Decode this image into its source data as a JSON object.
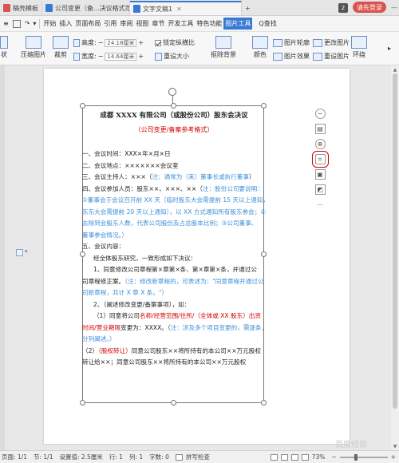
{
  "tabs": [
    {
      "label": "稿壳模板",
      "active": false
    },
    {
      "label": "公司变更（备...决议格式范本",
      "active": false
    },
    {
      "label": "文字文稿1",
      "active": true
    }
  ],
  "tab_badge": "2",
  "login_label": "请先登录",
  "menu": {
    "file_icon": "menu-lines-icon",
    "items": [
      "开始",
      "插入",
      "页面布局",
      "引用",
      "审阅",
      "视图",
      "章节",
      "开发工具",
      "特色功能",
      "图片工具"
    ],
    "active_item": "图片工具",
    "search_label": "Q查找"
  },
  "ribbon": {
    "left_cut": "状",
    "compress_label": "压缩图片",
    "crop_label": "裁剪",
    "height_label": "高度:",
    "height_value": "24.18厘米",
    "width_label": "宽度:",
    "width_value": "14.64厘米",
    "lock_ratio_label": "锁定纵横比",
    "reset_size_label": "重设大小",
    "matting_label": "抠除背景",
    "color_label": "颜色",
    "picture_outline_label": "图片轮廓",
    "change_picture_label": "更改图片",
    "picture_effect_label": "图片效果",
    "reset_picture_label": "重设图片",
    "wrap_label": "环绕"
  },
  "document": {
    "title": "成都 XXXX 有限公司（或股份公司）股东会决议",
    "subtitle": "（公司变更/备案参考格式）",
    "lines": [
      {
        "type": "plain",
        "text": "一、会议时间：XXX×年×月×日"
      },
      {
        "type": "plain",
        "text": "二、会议地点：×××××××会议室"
      },
      {
        "type": "mixed",
        "parts": [
          [
            "plain",
            "三、会议主持人：×××（"
          ],
          [
            "blue",
            "注：通常为（来）董事长或执行董事"
          ],
          [
            "plain",
            "）"
          ]
        ]
      },
      {
        "type": "mixed",
        "parts": [
          [
            "plain",
            "四、会议参加人员：股东××、×××、××（"
          ],
          [
            "blue",
            "注：股份公司要说明："
          ]
        ]
      },
      {
        "type": "blue",
        "text": "①董事会于会议召开前 XX 天（临时股东大会需提前 15 天以上通知，"
      },
      {
        "type": "blue",
        "text": "东东大会需提前 20 天以上通知），以 XX 方式通知所有股东参会；②"
      },
      {
        "type": "blue",
        "text": "去除到会股东人数，代表公司股份及占总股本比例；③公司董事、"
      },
      {
        "type": "blue",
        "text": "董事参会情况。）"
      },
      {
        "type": "plain",
        "text": "五、会议内容："
      },
      {
        "type": "plain",
        "indent": true,
        "text": "经全体股东研究，一致形成如下决议："
      },
      {
        "type": "plain",
        "indent": true,
        "text": "1、同意修改公司章程第×章第×条、第×章第×条，并通过公"
      },
      {
        "type": "mixed",
        "parts": [
          [
            "plain",
            "司章程修正案。"
          ],
          [
            "blue",
            "（注：修改新章程的，可表述为：\"同意章程并通过公"
          ]
        ]
      },
      {
        "type": "blue",
        "text": "司新章程，共计 X 章 X 条。\"）"
      },
      {
        "type": "plain",
        "indent": true,
        "text": "2、（阐述修改变更/备案事项），如："
      },
      {
        "type": "mixed",
        "indent": true,
        "parts": [
          [
            "plain",
            "（1）同意将公司"
          ],
          [
            "red",
            "名称/经营范围/住所/（全体或 XX 股东）出资"
          ]
        ]
      },
      {
        "type": "mixed",
        "parts": [
          [
            "red",
            "时间/营业期限"
          ],
          [
            "plain",
            "变更为：XXXX。（"
          ],
          [
            "blue",
            "注：涉及多个项目变更的，需逐条、"
          ]
        ]
      },
      {
        "type": "blue",
        "text": "分列阐述。）"
      },
      {
        "type": "mixed",
        "parts": [
          [
            "plain",
            "（2）"
          ],
          [
            "red",
            "（股权转让）"
          ],
          [
            "plain",
            "同意公司股东××将所持有的本公司××万元股权"
          ]
        ]
      },
      {
        "type": "plain",
        "text": "转让给××；同意公司股东××将所持有的本公司××万元股权"
      }
    ]
  },
  "status": {
    "page": "页面: 1/1",
    "section": "节: 1/1",
    "setting": "设置值: 2.5厘米",
    "row": "行: 1",
    "col": "列: 1",
    "words": "字数: 0",
    "spellcheck": "拼写检查",
    "zoom": "73%"
  },
  "zoom_level": 0.73,
  "watermark": "百度经验",
  "colors": {
    "accent": "#3a7ad5",
    "annotation_red": "#d00000",
    "note_blue": "#3e8fd8"
  }
}
